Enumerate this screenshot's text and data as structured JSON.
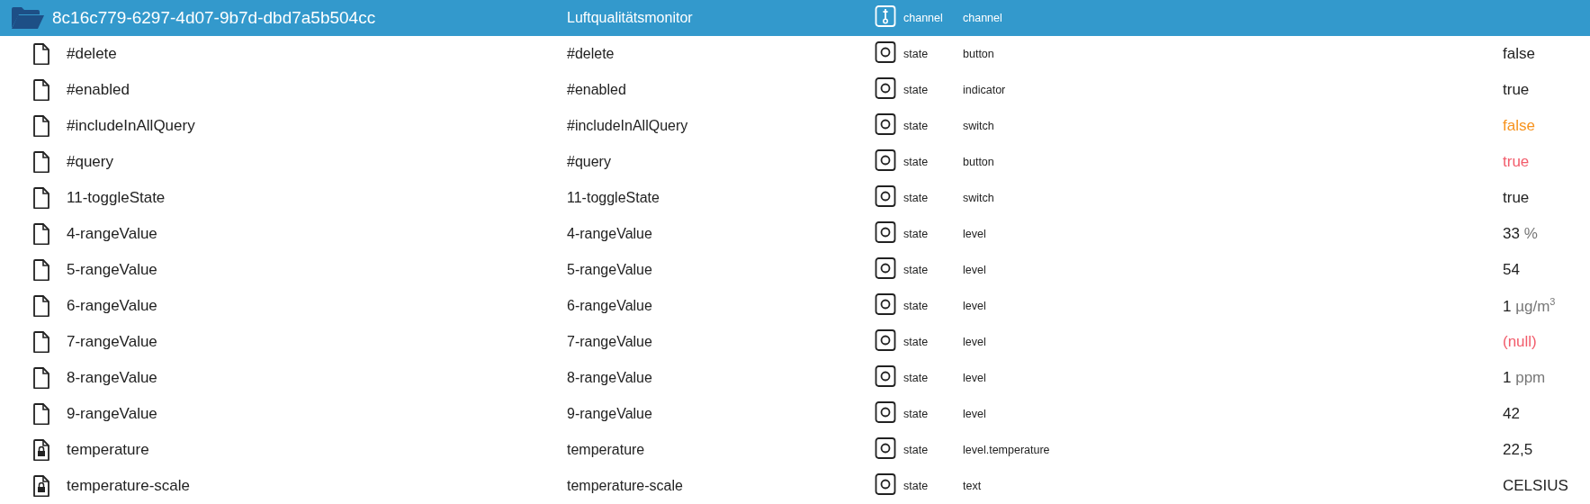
{
  "channel": {
    "id": "8c16c779-6297-4d07-9b7d-dbd7a5b504cc",
    "name": "Luftqualitätsmonitor",
    "type": "channel",
    "role": "channel",
    "expanded": true,
    "selected": true
  },
  "states": [
    {
      "id": "#delete",
      "name": "#delete",
      "locked": false,
      "type": "state",
      "role": "button",
      "value": "false",
      "color": "#222222"
    },
    {
      "id": "#enabled",
      "name": "#enabled",
      "locked": false,
      "type": "state",
      "role": "indicator",
      "value": "true",
      "color": "#222222"
    },
    {
      "id": "#includeInAllQuery",
      "name": "#includeInAllQuery",
      "locked": false,
      "type": "state",
      "role": "switch",
      "value": "false",
      "color": "#f7931e"
    },
    {
      "id": "#query",
      "name": "#query",
      "locked": false,
      "type": "state",
      "role": "button",
      "value": "true",
      "color": "#f25c6b"
    },
    {
      "id": "11-toggleState",
      "name": "11-toggleState",
      "locked": false,
      "type": "state",
      "role": "switch",
      "value": "true",
      "color": "#222222"
    },
    {
      "id": "4-rangeValue",
      "name": "4-rangeValue",
      "locked": false,
      "type": "state",
      "role": "level",
      "value": "33",
      "unit": "%",
      "color": "#222222"
    },
    {
      "id": "5-rangeValue",
      "name": "5-rangeValue",
      "locked": false,
      "type": "state",
      "role": "level",
      "value": "54",
      "color": "#222222"
    },
    {
      "id": "6-rangeValue",
      "name": "6-rangeValue",
      "locked": false,
      "type": "state",
      "role": "level",
      "value": "1",
      "unit": "µg/m$^{3}$",
      "color": "#222222"
    },
    {
      "id": "7-rangeValue",
      "name": "7-rangeValue",
      "locked": false,
      "type": "state",
      "role": "level",
      "value": "(null)",
      "color": "#f25c6b"
    },
    {
      "id": "8-rangeValue",
      "name": "8-rangeValue",
      "locked": false,
      "type": "state",
      "role": "level",
      "value": "1",
      "unit": "ppm",
      "color": "#222222"
    },
    {
      "id": "9-rangeValue",
      "name": "9-rangeValue",
      "locked": false,
      "type": "state",
      "role": "level",
      "value": "42",
      "color": "#222222"
    },
    {
      "id": "temperature",
      "name": "temperature",
      "locked": true,
      "type": "state",
      "role": "level.temperature",
      "value": "22,5",
      "color": "#222222"
    },
    {
      "id": "temperature-scale",
      "name": "temperature-scale",
      "locked": true,
      "type": "state",
      "role": "text",
      "value": "CELSIUS",
      "color": "#222222"
    }
  ]
}
